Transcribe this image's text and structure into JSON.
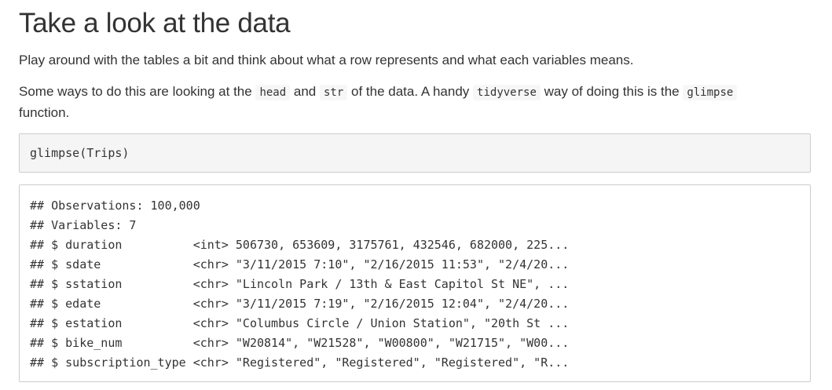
{
  "title": "Take a look at the data",
  "intro": "Play around with the tables a bit and think about what a row represents and what each variables means.",
  "para2": {
    "t1": "Some ways to do this are looking at the ",
    "c1": "head",
    "t2": " and ",
    "c2": "str",
    "t3": " of the data. A handy ",
    "c3": "tidyverse",
    "t4": " way of doing this is the ",
    "c4": "glimpse",
    "t5": " function."
  },
  "code_block": {
    "code": "glimpse(Trips)"
  },
  "output": {
    "lines": [
      "## Observations: 100,000",
      "## Variables: 7",
      "## $ duration          <int> 506730, 653609, 3175761, 432546, 682000, 225...",
      "## $ sdate             <chr> \"3/11/2015 7:10\", \"2/16/2015 11:53\", \"2/4/20...",
      "## $ sstation          <chr> \"Lincoln Park / 13th & East Capitol St NE\", ...",
      "## $ edate             <chr> \"3/11/2015 7:19\", \"2/16/2015 12:04\", \"2/4/20...",
      "## $ estation          <chr> \"Columbus Circle / Union Station\", \"20th St ...",
      "## $ bike_num          <chr> \"W20814\", \"W21528\", \"W00800\", \"W21715\", \"W00...",
      "## $ subscription_type <chr> \"Registered\", \"Registered\", \"Registered\", \"R..."
    ]
  }
}
